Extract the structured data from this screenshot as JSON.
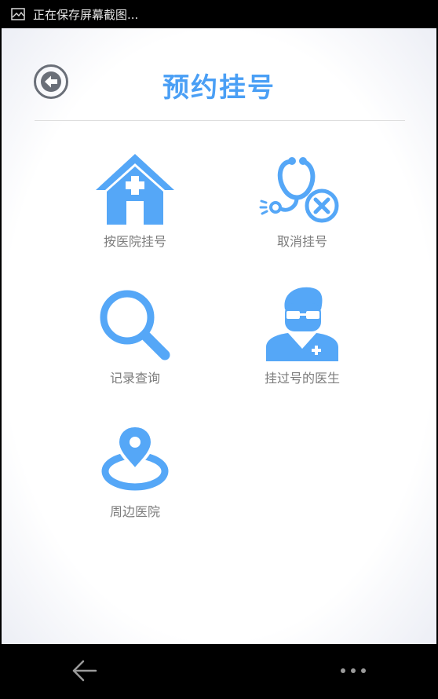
{
  "status_bar": {
    "text": "正在保存屏幕截图..."
  },
  "header": {
    "title": "预约挂号"
  },
  "menu": {
    "items": [
      {
        "label": "按医院挂号",
        "icon": "hospital-icon"
      },
      {
        "label": "取消挂号",
        "icon": "cancel-stethoscope-icon"
      },
      {
        "label": "记录查询",
        "icon": "search-icon"
      },
      {
        "label": "挂过号的医生",
        "icon": "doctor-icon"
      },
      {
        "label": "周边医院",
        "icon": "location-pin-icon"
      }
    ]
  },
  "nav_bar": {
    "back_icon": "back-arrow-icon",
    "more_icon": "more-dots-icon"
  },
  "colors": {
    "accent": "#4a9ff5",
    "icon_blue": "#55a7f7",
    "label_gray": "#7c7c7c"
  }
}
